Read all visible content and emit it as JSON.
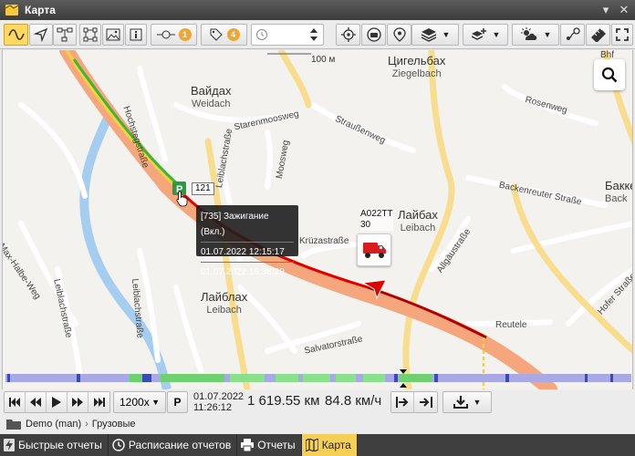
{
  "window": {
    "title": "Карта"
  },
  "toolbar": {
    "geofence_count": "1",
    "poi_count": "4"
  },
  "map": {
    "scale_label": "100 м",
    "places": [
      {
        "name": "Вайдах",
        "sub": "Weidach"
      },
      {
        "name": "Цигельбах",
        "sub": "Ziegelbach"
      },
      {
        "name": "Лайбах",
        "sub": "Leibach"
      },
      {
        "name": "Лайблах",
        "sub": "Leibach"
      },
      {
        "name": "Бакке",
        "sub": "Back"
      }
    ],
    "streets": [
      "Hochstegstraße",
      "Starenmoosweg",
      "Moosweg",
      "Straußenweg",
      "Rosenweg",
      "Backenreuter Straße",
      "Krüzastraße",
      "Allgäustraße",
      "Reutele",
      "Hofer Straße",
      "Max-Halbe-Weg",
      "Leiblachstraße",
      "Leiblachstraße",
      "Salvatorstraße",
      "Bhf",
      "Leiblachstraße"
    ],
    "parking_label": "121",
    "tooltip": {
      "event": "[735] Зажигание (Вкл.)",
      "start": "01.07.2022 12:15:17",
      "end": "01.07.2022 16:38:29"
    },
    "vehicle": {
      "name_line1": "A022TT",
      "name_line2": "30"
    }
  },
  "playback": {
    "speed_multiplier": "1200x",
    "p_label": "P",
    "date": "01.07.2022",
    "time": "11:26:12",
    "distance": "1 619.55 км",
    "speed": "84.8 км/ч"
  },
  "breadcrumb": {
    "root": "Demo (man)",
    "group": "Грузовые"
  },
  "tabs": [
    {
      "label": "Быстрые отчеты",
      "icon": "lightning-icon"
    },
    {
      "label": "Расписание отчетов",
      "icon": "clock-icon"
    },
    {
      "label": "Отчеты",
      "icon": "printer-icon"
    },
    {
      "label": "Карта",
      "icon": "map-icon"
    }
  ],
  "colors": {
    "accent": "#f6cf57",
    "track_red": "#e00000",
    "track_green": "#3db53d",
    "track_yellow": "#f5d23d",
    "route_orange": "#f5a67c"
  }
}
